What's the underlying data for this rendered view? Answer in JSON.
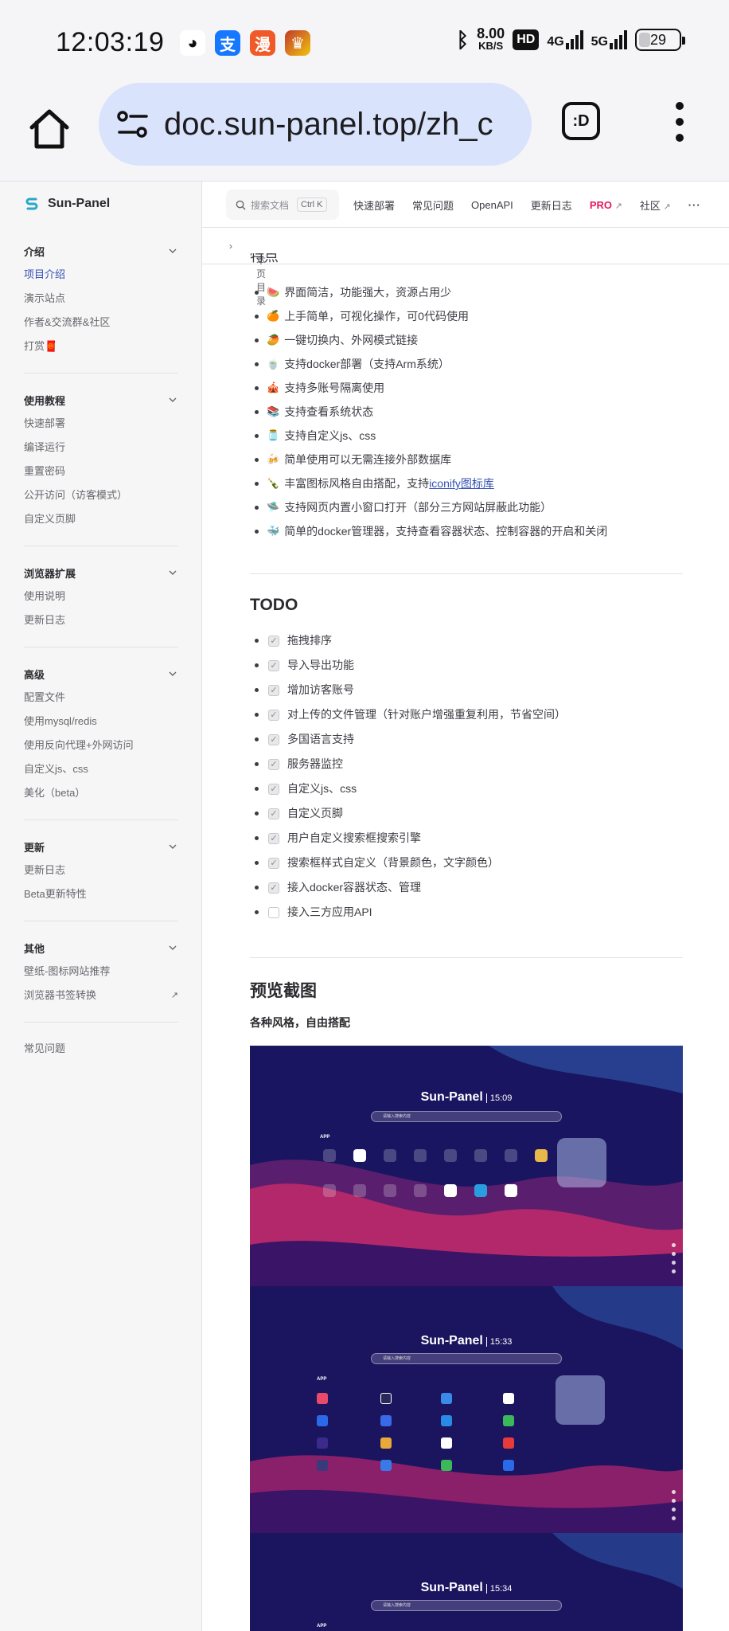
{
  "status_bar": {
    "time": "12:03:19",
    "speed_value": "8.00",
    "speed_unit": "KB/S",
    "hd": "HD",
    "net1": "4G",
    "net2": "5G",
    "battery": "29",
    "apps": [
      "wechat-icon",
      "alipay-icon",
      "manga-icon",
      "game-icon"
    ]
  },
  "browser": {
    "url": "doc.sun-panel.top/zh_c",
    "tabs_label": ":D"
  },
  "sidebar": {
    "logo": "Sun-Panel",
    "groups": [
      {
        "title": "介绍",
        "items": [
          "项目介绍",
          "演示站点",
          "作者&交流群&社区",
          "打赏🧧"
        ]
      },
      {
        "title": "使用教程",
        "items": [
          "快速部署",
          "编译运行",
          "重置密码",
          "公开访问（访客模式）",
          "自定义页脚"
        ]
      },
      {
        "title": "浏览器扩展",
        "items": [
          "使用说明",
          "更新日志"
        ]
      },
      {
        "title": "高级",
        "items": [
          "配置文件",
          "使用mysql/redis",
          "使用反向代理+外网访问",
          "自定义js、css",
          "美化（beta）"
        ]
      },
      {
        "title": "更新",
        "items": [
          "更新日志",
          "Beta更新特性"
        ]
      },
      {
        "title": "其他",
        "items": [
          "壁纸-图标网站推荐",
          "浏览器书签转换"
        ]
      }
    ],
    "footer_item": "常见问题"
  },
  "topnav": {
    "search_placeholder": "搜索文档",
    "search_kbd": "Ctrl K",
    "links": [
      "快速部署",
      "常见问题",
      "OpenAPI",
      "更新日志"
    ],
    "pro": "PRO",
    "community": "社区",
    "more": "···"
  },
  "outline": "本页目录",
  "features": [
    {
      "emoji": "🍉",
      "text": "界面简洁，功能强大，资源占用少"
    },
    {
      "emoji": "🍊",
      "text": "上手简单，可视化操作，可0代码使用"
    },
    {
      "emoji": "🥭",
      "text": "一键切换内、外网模式链接"
    },
    {
      "emoji": "🍵",
      "text": "支持docker部署（支持Arm系统）"
    },
    {
      "emoji": "🎪",
      "text": "支持多账号隔离使用"
    },
    {
      "emoji": "📚",
      "text": "支持查看系统状态"
    },
    {
      "emoji": "🫙",
      "text": "支持自定义js、css"
    },
    {
      "emoji": "🍻",
      "text": "简单使用可以无需连接外部数据库"
    },
    {
      "emoji": "🍾",
      "text": "丰富图标风格自由搭配，支持",
      "link": "iconify图标库"
    },
    {
      "emoji": "🛸",
      "text": "支持网页内置小窗口打开（部分三方网站屏蔽此功能）"
    },
    {
      "emoji": "🐳",
      "text": "简单的docker管理器，支持查看容器状态、控制容器的开启和关闭"
    }
  ],
  "todo_title": "TODO",
  "todo": [
    {
      "text": "拖拽排序",
      "done": true
    },
    {
      "text": "导入导出功能",
      "done": true
    },
    {
      "text": "增加访客账号",
      "done": true
    },
    {
      "text": "对上传的文件管理（针对账户增强重复利用，节省空间）",
      "done": true
    },
    {
      "text": "多国语言支持",
      "done": true
    },
    {
      "text": "服务器监控",
      "done": true
    },
    {
      "text": "自定义js、css",
      "done": true
    },
    {
      "text": "自定义页脚",
      "done": true
    },
    {
      "text": "用户自定义搜索框搜索引擎",
      "done": true
    },
    {
      "text": "搜索框样式自定义（背景颜色，文字颜色）",
      "done": true
    },
    {
      "text": "接入docker容器状态、管理",
      "done": true
    },
    {
      "text": "接入三方应用API",
      "done": false
    }
  ],
  "preview_title": "预览截图",
  "preview_subtitle": "各种风格，自由搭配",
  "screens": [
    {
      "brand": "Sun-Panel",
      "time": "15:09",
      "search": "请输入搜索内容",
      "group": "APP"
    },
    {
      "brand": "Sun-Panel",
      "time": "15:33",
      "search": "请输入搜索内容",
      "group": "APP"
    },
    {
      "brand": "Sun-Panel",
      "time": "15:34",
      "search": "请输入搜索内容",
      "group": "APP"
    }
  ]
}
